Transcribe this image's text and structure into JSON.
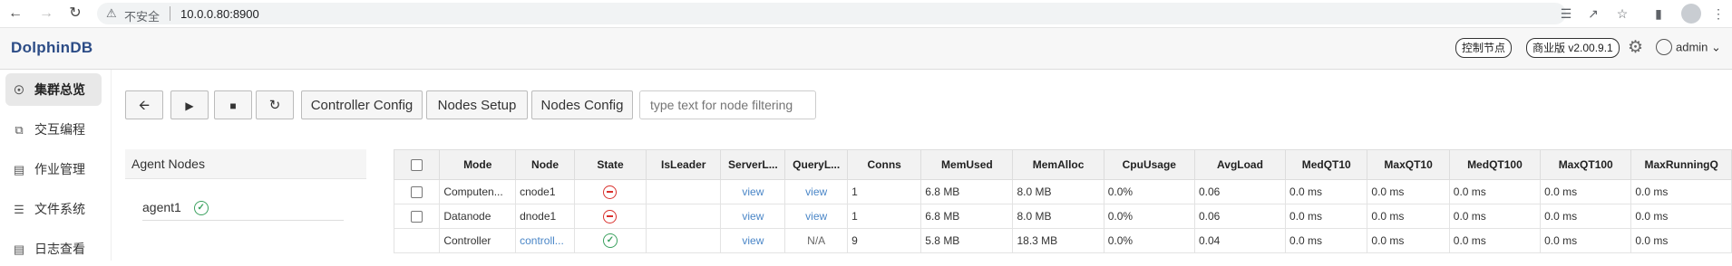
{
  "browser": {
    "security_label": "不安全",
    "url": "10.0.0.80:8900"
  },
  "header": {
    "logo": "DolphinDB",
    "node_badge": "控制节点",
    "edition_badge": "商业版 v2.00.9.1",
    "user": "admin"
  },
  "sidebar": {
    "items": [
      {
        "label": "集群总览",
        "icon": "cluster-icon"
      },
      {
        "label": "交互编程",
        "icon": "code-icon"
      },
      {
        "label": "作业管理",
        "icon": "job-icon"
      },
      {
        "label": "文件系统",
        "icon": "file-system-icon"
      },
      {
        "label": "日志查看",
        "icon": "log-icon"
      }
    ]
  },
  "toolbar": {
    "controller_config": "Controller Config",
    "nodes_setup": "Nodes Setup",
    "nodes_config": "Nodes Config",
    "filter_placeholder": "type text for node filtering"
  },
  "agent_panel": {
    "title": "Agent Nodes",
    "agents": [
      {
        "name": "agent1",
        "status": "running"
      }
    ]
  },
  "nodes_table": {
    "headers": [
      "Mode",
      "Node",
      "State",
      "IsLeader",
      "ServerL...",
      "QueryL...",
      "Conns",
      "MemUsed",
      "MemAlloc",
      "CpuUsage",
      "AvgLoad",
      "MedQT10",
      "MaxQT10",
      "MedQT100",
      "MaxQT100",
      "MaxRunningQ"
    ],
    "rows": [
      {
        "mode": "Computen...",
        "node": "cnode1",
        "state": "stopped",
        "isleader": "",
        "server_log": "view",
        "query_log": "view",
        "conns": "1",
        "memused": "6.8 MB",
        "memalloc": "8.0 MB",
        "cpu": "0.0%",
        "avgload": "0.06",
        "medqt10": "0.0 ms",
        "maxqt10": "0.0 ms",
        "medqt100": "0.0 ms",
        "maxqt100": "0.0 ms",
        "maxrunning": "0.0 ms"
      },
      {
        "mode": "Datanode",
        "node": "dnode1",
        "state": "stopped",
        "isleader": "",
        "server_log": "view",
        "query_log": "view",
        "conns": "1",
        "memused": "6.8 MB",
        "memalloc": "8.0 MB",
        "cpu": "0.0%",
        "avgload": "0.06",
        "medqt10": "0.0 ms",
        "maxqt10": "0.0 ms",
        "medqt100": "0.0 ms",
        "maxqt100": "0.0 ms",
        "maxrunning": "0.0 ms"
      },
      {
        "mode": "Controller",
        "node": "controll...",
        "state": "running",
        "isleader": "",
        "server_log": "view",
        "query_log": "N/A",
        "conns": "9",
        "memused": "5.8 MB",
        "memalloc": "18.3 MB",
        "cpu": "0.0%",
        "avgload": "0.04",
        "medqt10": "0.0 ms",
        "maxqt10": "0.0 ms",
        "medqt100": "0.0 ms",
        "maxqt100": "0.0 ms",
        "maxrunning": "0.0 ms"
      }
    ]
  },
  "colors": {
    "link": "#4a86c7",
    "running": "#3ba15f",
    "stopped": "#d9312d"
  }
}
